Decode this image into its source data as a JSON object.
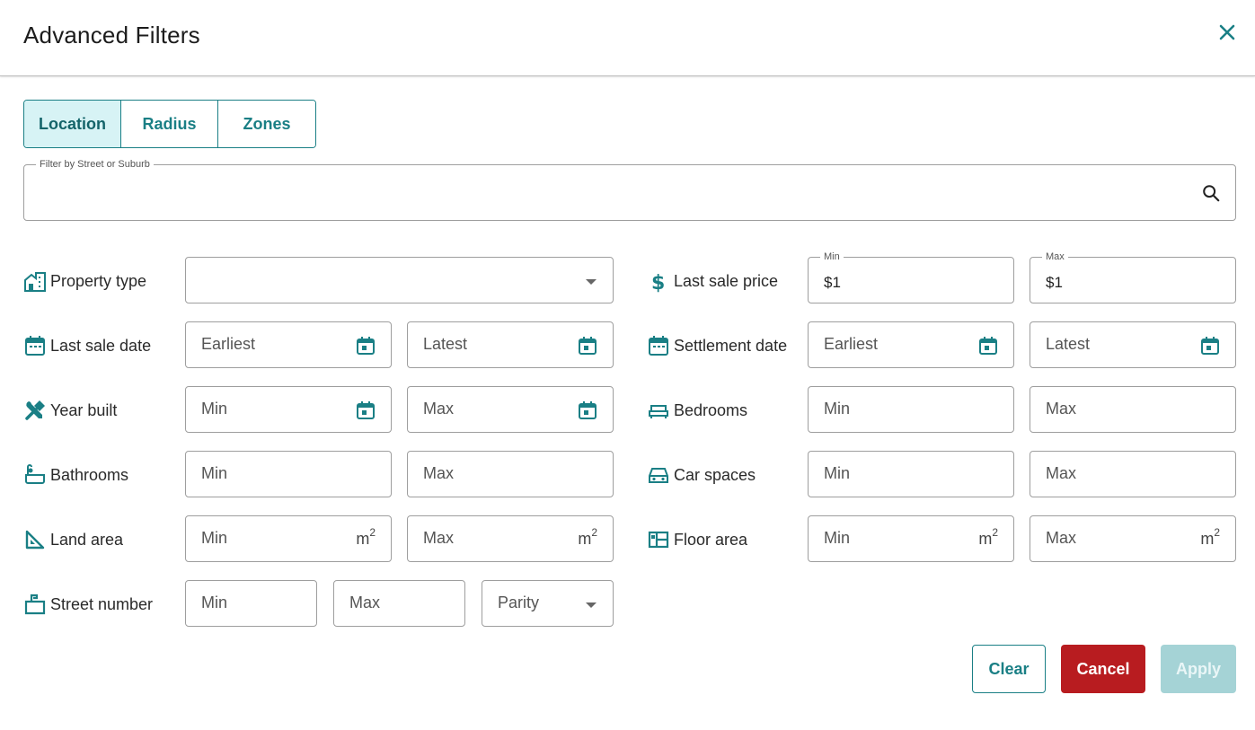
{
  "dialog": {
    "title": "Advanced Filters",
    "close_icon": "close-icon"
  },
  "tabs": [
    {
      "label": "Location",
      "active": true
    },
    {
      "label": "Radius",
      "active": false
    },
    {
      "label": "Zones",
      "active": false
    }
  ],
  "search": {
    "legend": "Filter by Street or Suburb",
    "value": "",
    "icon": "search-icon"
  },
  "filters": {
    "property_type": {
      "label": "Property type",
      "value": ""
    },
    "last_sale_price": {
      "label": "Last sale price",
      "min_legend": "Min",
      "min_value": "$1",
      "max_legend": "Max",
      "max_value": "$1"
    },
    "last_sale_date": {
      "label": "Last sale date",
      "earliest": "Earliest",
      "latest": "Latest"
    },
    "settlement_date": {
      "label": "Settlement date",
      "earliest": "Earliest",
      "latest": "Latest"
    },
    "year_built": {
      "label": "Year built",
      "min": "Min",
      "max": "Max"
    },
    "bedrooms": {
      "label": "Bedrooms",
      "min": "Min",
      "max": "Max"
    },
    "bathrooms": {
      "label": "Bathrooms",
      "min": "Min",
      "max": "Max"
    },
    "car_spaces": {
      "label": "Car spaces",
      "min": "Min",
      "max": "Max"
    },
    "land_area": {
      "label": "Land area",
      "min": "Min",
      "max": "Max",
      "unit": "m",
      "unit_sup": "2"
    },
    "floor_area": {
      "label": "Floor area",
      "min": "Min",
      "max": "Max",
      "unit": "m",
      "unit_sup": "2"
    },
    "street_number": {
      "label": "Street number",
      "min": "Min",
      "max": "Max",
      "parity": "Parity"
    }
  },
  "actions": {
    "clear": "Clear",
    "cancel": "Cancel",
    "apply": "Apply"
  },
  "colors": {
    "accent": "#1a7f85",
    "tab_active_bg": "#d7f3f5",
    "cancel": "#b81c20",
    "apply_disabled": "#a5d3d6"
  }
}
